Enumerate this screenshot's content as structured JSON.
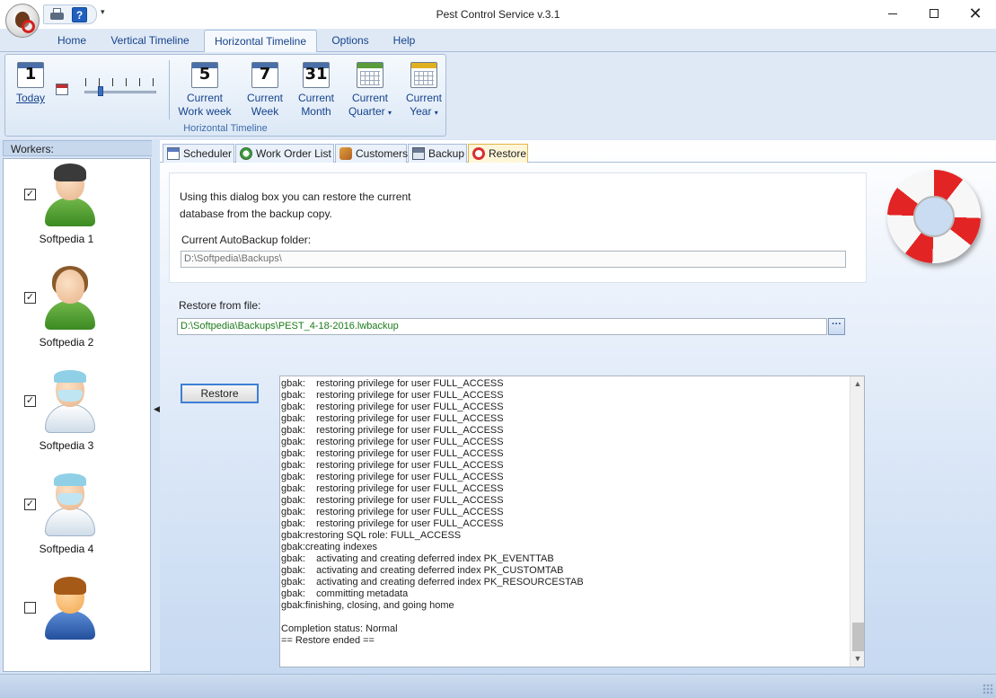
{
  "window": {
    "title": "Pest Control Service v.3.1",
    "min_icon": "minimize-icon",
    "max_icon": "maximize-icon",
    "close_glyph": "✕"
  },
  "qat": {
    "help_glyph": "?",
    "dropdown_glyph": "▾"
  },
  "ribbon": {
    "tabs": [
      "Home",
      "Vertical Timeline",
      "Horizontal Timeline",
      "Options",
      "Help"
    ],
    "active_tab": "Horizontal Timeline",
    "group_label": "Horizontal Timeline",
    "today": {
      "num": "1",
      "label": "Today"
    },
    "work_week": {
      "num": "5",
      "label1": "Current",
      "label2": "Work week"
    },
    "week": {
      "num": "7",
      "label1": "Current",
      "label2": "Week"
    },
    "month": {
      "num": "31",
      "label1": "Current",
      "label2": "Month"
    },
    "quarter": {
      "label1": "Current",
      "label2": "Quarter"
    },
    "year": {
      "label1": "Current",
      "label2": "Year"
    },
    "zoom_level": 0.2
  },
  "workers": {
    "header": "Workers:",
    "items": [
      {
        "name": "Softpedia 1",
        "checked": "☑",
        "check_mark": "✓"
      },
      {
        "name": "Softpedia 2",
        "checked": "☑",
        "check_mark": "✓"
      },
      {
        "name": "Softpedia 3",
        "checked": "☑",
        "check_mark": "✓"
      },
      {
        "name": "Softpedia 4",
        "checked": "☑",
        "check_mark": "✓"
      },
      {
        "name": "",
        "checked": "☐",
        "check_mark": ""
      }
    ]
  },
  "tabs": {
    "scheduler": "Scheduler",
    "work_order_list": "Work Order List",
    "customers": "Customers",
    "backup": "Backup",
    "restore": "Restore",
    "active": "Restore"
  },
  "restore_page": {
    "info_line1": "Using this dialog box you can restore the current",
    "info_line2": "database from the backup copy.",
    "autobackup_label": "Current AutoBackup folder:",
    "autobackup_value": "D:\\Softpedia\\Backups\\",
    "restore_from_label": "Restore from file:",
    "restore_file_value": "D:\\Softpedia\\Backups\\PEST_4-18-2016.lwbackup",
    "browse_label": "···",
    "restore_button": "Restore",
    "log": [
      "gbak:    restoring privilege for user FULL_ACCESS",
      "gbak:    restoring privilege for user FULL_ACCESS",
      "gbak:    restoring privilege for user FULL_ACCESS",
      "gbak:    restoring privilege for user FULL_ACCESS",
      "gbak:    restoring privilege for user FULL_ACCESS",
      "gbak:    restoring privilege for user FULL_ACCESS",
      "gbak:    restoring privilege for user FULL_ACCESS",
      "gbak:    restoring privilege for user FULL_ACCESS",
      "gbak:    restoring privilege for user FULL_ACCESS",
      "gbak:    restoring privilege for user FULL_ACCESS",
      "gbak:    restoring privilege for user FULL_ACCESS",
      "gbak:    restoring privilege for user FULL_ACCESS",
      "gbak:    restoring privilege for user FULL_ACCESS",
      "gbak:restoring SQL role: FULL_ACCESS",
      "gbak:creating indexes",
      "gbak:    activating and creating deferred index PK_EVENTTAB",
      "gbak:    activating and creating deferred index PK_CUSTOMTAB",
      "gbak:    activating and creating deferred index PK_RESOURCESTAB",
      "gbak:    committing metadata",
      "gbak:finishing, closing, and going home",
      "",
      "Completion status: Normal",
      "== Restore ended =="
    ]
  },
  "colors": {
    "accent": "#15428b",
    "file_path": "#1a7a1a",
    "ribbon_bg": "#dfe9f5",
    "lifebuoy_red": "#e32424"
  }
}
